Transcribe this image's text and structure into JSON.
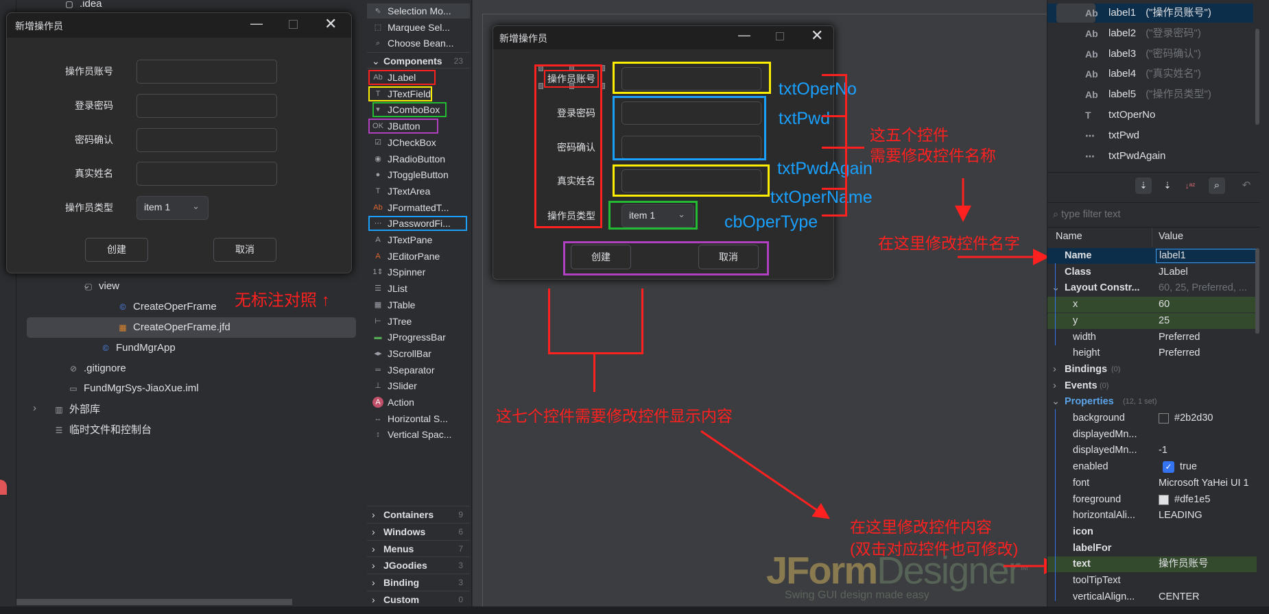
{
  "colors": {
    "panel": "#2b2d30",
    "canvas": "#3b3d40",
    "annotation_red": "#ff2020",
    "annotation_blue": "#1aa0ff",
    "selection": "#0d2e4a",
    "highlight_green": "#344a2c"
  },
  "reference_dialog": {
    "title": "新增操作员",
    "labels": [
      "操作员账号",
      "登录密码",
      "密码确认",
      "真实姓名",
      "操作员类型"
    ],
    "combo_value": "item 1",
    "buttons": [
      "创建",
      "取消"
    ]
  },
  "project_tree": {
    "top_partial": ".idea",
    "items": [
      {
        "label": "view",
        "icon": "folder-icon",
        "glyph": "▢",
        "chevron": "⌄"
      },
      {
        "label": "CreateOperFrame",
        "icon": "class-icon",
        "glyph": "©"
      },
      {
        "label": "CreateOperFrame.jfd",
        "icon": "jfd-file-icon",
        "glyph": "▦",
        "selected": true
      },
      {
        "label": "FundMgrApp",
        "icon": "app-class-icon",
        "glyph": "©"
      },
      {
        "label": ".gitignore",
        "icon": "ignore-file-icon",
        "glyph": "⊘"
      },
      {
        "label": "FundMgrSys-JiaoXue.iml",
        "icon": "module-file-icon",
        "glyph": "▭"
      },
      {
        "label": "外部库",
        "icon": "library-icon",
        "glyph": "▥",
        "chevron": "›"
      },
      {
        "label": "临时文件和控制台",
        "icon": "scratches-icon",
        "glyph": "☰"
      }
    ]
  },
  "palette": {
    "tools": [
      {
        "label": "Selection Mo...",
        "icon": "cursor-icon",
        "glyph": "⇖"
      },
      {
        "label": "Marquee Sel...",
        "icon": "marquee-icon",
        "glyph": "⬚"
      },
      {
        "label": "Choose Bean...",
        "icon": "choose-bean-icon",
        "glyph": "⌕"
      }
    ],
    "components_header": "Components",
    "components_count": "23",
    "components": [
      {
        "label": "JLabel",
        "glyph": "Ab",
        "box": "#ff2020"
      },
      {
        "label": "JTextField",
        "glyph": "T",
        "box": "#ffee00"
      },
      {
        "label": "JComboBox",
        "glyph": "▾",
        "box": "#22bb33"
      },
      {
        "label": "JButton",
        "glyph": "OK",
        "box": "#b040c0"
      },
      {
        "label": "JCheckBox",
        "glyph": "☑"
      },
      {
        "label": "JRadioButton",
        "glyph": "◉"
      },
      {
        "label": "JToggleButton",
        "glyph": "●"
      },
      {
        "label": "JTextArea",
        "glyph": "T"
      },
      {
        "label": "JFormattedT...",
        "glyph": "Ab"
      },
      {
        "label": "JPasswordFi...",
        "glyph": "⋯",
        "box": "#1aa0ff"
      },
      {
        "label": "JTextPane",
        "glyph": "A"
      },
      {
        "label": "JEditorPane",
        "glyph": "A"
      },
      {
        "label": "JSpinner",
        "glyph": "1⇕"
      },
      {
        "label": "JList",
        "glyph": "☰"
      },
      {
        "label": "JTable",
        "glyph": "▦"
      },
      {
        "label": "JTree",
        "glyph": "⊢"
      },
      {
        "label": "JProgressBar",
        "glyph": "▬"
      },
      {
        "label": "JScrollBar",
        "glyph": "◂▸"
      },
      {
        "label": "JSeparator",
        "glyph": "═"
      },
      {
        "label": "JSlider",
        "glyph": "⊥"
      },
      {
        "label": "Action",
        "glyph": "A"
      },
      {
        "label": "Horizontal S...",
        "glyph": "↔"
      },
      {
        "label": "Vertical Spac...",
        "glyph": "↕"
      }
    ],
    "categories": [
      {
        "label": "Containers",
        "count": "9"
      },
      {
        "label": "Windows",
        "count": "6"
      },
      {
        "label": "Menus",
        "count": "7"
      },
      {
        "label": "JGoodies",
        "count": "3"
      },
      {
        "label": "Binding",
        "count": "3"
      },
      {
        "label": "Custom",
        "count": "0"
      }
    ]
  },
  "design_form": {
    "title": "新增操作员",
    "labels": [
      "操作员账号",
      "登录密码",
      "密码确认",
      "真实姓名",
      "操作员类型"
    ],
    "combo_value": "item 1",
    "buttons": [
      "创建",
      "取消"
    ]
  },
  "annotations": {
    "no_markup": "无标注对照 ↑",
    "field_names": [
      "txtOperNo",
      "txtPwd",
      "txtPwdAgain",
      "txtOperName",
      "cbOperType"
    ],
    "rename_note_1": "这五个控件",
    "rename_note_2": "需要修改控件名称",
    "rename_here": "在这里修改控件名字",
    "seven_controls": "这七个控件需要修改控件显示内容",
    "edit_here_1": "在这里修改控件内容",
    "edit_here_2": "(双击对应控件也可修改)"
  },
  "logo": {
    "brand_a": "JForm",
    "brand_b": "Designer",
    "tm": "TM",
    "tagline": "Swing GUI design made easy"
  },
  "component_tree": [
    {
      "name": "label1",
      "hint": "(\"操作员账号\")",
      "glyph": "Ab",
      "selected": true
    },
    {
      "name": "label2",
      "hint": "(\"登录密码\")",
      "glyph": "Ab"
    },
    {
      "name": "label3",
      "hint": "(\"密码确认\")",
      "glyph": "Ab"
    },
    {
      "name": "label4",
      "hint": "(\"真实姓名\")",
      "glyph": "Ab"
    },
    {
      "name": "label5",
      "hint": "(\"操作员类型\")",
      "glyph": "Ab"
    },
    {
      "name": "txtOperNo",
      "hint": "",
      "glyph": "T"
    },
    {
      "name": "txtPwd",
      "hint": "",
      "glyph": "⋯"
    },
    {
      "name": "txtPwdAgain",
      "hint": "",
      "glyph": "⋯"
    }
  ],
  "property_toolbar": {
    "filter_placeholder": "type filter text"
  },
  "properties": {
    "headers": [
      "Name",
      "Value"
    ],
    "rows": [
      {
        "name": "Name",
        "value": "label1",
        "level": 0,
        "bold": true,
        "selected": true
      },
      {
        "name": "Class",
        "value": "JLabel",
        "level": 0,
        "bold": true
      },
      {
        "name": "Layout Constr...",
        "value": "60, 25, Preferred, ...",
        "level": 0,
        "bold": true,
        "expanded": true,
        "dim": true
      },
      {
        "name": "x",
        "value": "60",
        "level": 1,
        "green": true
      },
      {
        "name": "y",
        "value": "25",
        "level": 1,
        "green": true
      },
      {
        "name": "width",
        "value": "Preferred",
        "level": 1
      },
      {
        "name": "height",
        "value": "Preferred",
        "level": 1
      },
      {
        "name": "Bindings",
        "extra": "(0)",
        "level": 0,
        "bold": true,
        "collapsed": true
      },
      {
        "name": "Events",
        "extra": "(0)",
        "level": 0,
        "bold": true,
        "collapsed": true
      },
      {
        "name": "Properties",
        "extra": "(12, 1 set)",
        "level": 0,
        "bold": true,
        "expanded": true,
        "accent": true
      },
      {
        "name": "background",
        "value": "#2b2d30",
        "level": 1,
        "swatch": "#2b2d30"
      },
      {
        "name": "displayedMn...",
        "value": "",
        "level": 1
      },
      {
        "name": "displayedMn...",
        "value": "-1",
        "level": 1
      },
      {
        "name": "enabled",
        "value": "true",
        "level": 1,
        "checkbox": true
      },
      {
        "name": "font",
        "value": "Microsoft YaHei UI 1",
        "level": 1
      },
      {
        "name": "foreground",
        "value": "#dfe1e5",
        "level": 1,
        "swatch": "#dfe1e5"
      },
      {
        "name": "horizontalAli...",
        "value": "LEADING",
        "level": 1
      },
      {
        "name": "icon",
        "value": "",
        "level": 1,
        "bold": true
      },
      {
        "name": "labelFor",
        "value": "",
        "level": 1,
        "bold": true
      },
      {
        "name": "text",
        "value": "操作员账号",
        "level": 1,
        "bold": true,
        "green": true
      },
      {
        "name": "toolTipText",
        "value": "",
        "level": 1
      },
      {
        "name": "verticalAlign...",
        "value": "CENTER",
        "level": 1
      }
    ]
  }
}
